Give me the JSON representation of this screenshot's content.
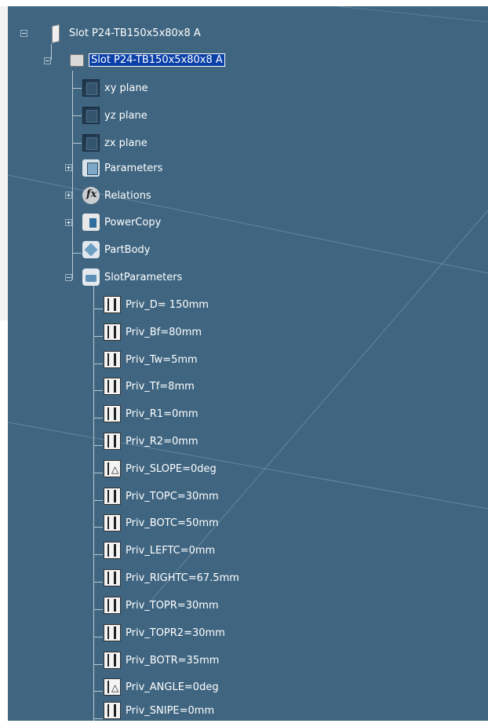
{
  "colors": {
    "background": "#3f6580",
    "tree_line": "#b7c8d4",
    "text": "#ffffff",
    "selection": "#0a3fa8"
  },
  "tree": {
    "root": {
      "label": "Slot P24-TB150x5x80x8 A",
      "icon": "document-icon",
      "expanded": true
    },
    "part": {
      "label": "Slot P24-TB150x5x80x8 A",
      "icon": "part-icon",
      "expanded": true,
      "selected": true
    },
    "children": [
      {
        "label": "xy plane",
        "icon": "plane-icon"
      },
      {
        "label": "yz plane",
        "icon": "plane-icon"
      },
      {
        "label": "zx plane",
        "icon": "plane-icon"
      },
      {
        "label": "Parameters",
        "icon": "parameters-icon",
        "collapsed": true
      },
      {
        "label": "Relations",
        "icon": "relations-icon",
        "collapsed": true
      },
      {
        "label": "PowerCopy",
        "icon": "powercopy-icon",
        "collapsed": true
      },
      {
        "label": "PartBody",
        "icon": "partbody-icon"
      },
      {
        "label": "SlotParameters",
        "icon": "slotparameters-icon",
        "expanded": true
      }
    ],
    "slot_parameters": [
      {
        "label": "Priv_D= 150mm",
        "icon": "length-parameter-icon"
      },
      {
        "label": "Priv_Bf=80mm",
        "icon": "length-parameter-icon"
      },
      {
        "label": "Priv_Tw=5mm",
        "icon": "length-parameter-icon"
      },
      {
        "label": "Priv_Tf=8mm",
        "icon": "length-parameter-icon"
      },
      {
        "label": "Priv_R1=0mm",
        "icon": "length-parameter-icon"
      },
      {
        "label": "Priv_R2=0mm",
        "icon": "length-parameter-icon"
      },
      {
        "label": "Priv_SLOPE=0deg",
        "icon": "angle-parameter-icon"
      },
      {
        "label": "Priv_TOPC=30mm",
        "icon": "length-parameter-icon"
      },
      {
        "label": "Priv_BOTC=50mm",
        "icon": "length-parameter-icon"
      },
      {
        "label": "Priv_LEFTC=0mm",
        "icon": "length-parameter-icon"
      },
      {
        "label": "Priv_RIGHTC=67.5mm",
        "icon": "length-parameter-icon"
      },
      {
        "label": "Priv_TOPR=30mm",
        "icon": "length-parameter-icon"
      },
      {
        "label": "Priv_TOPR2=30mm",
        "icon": "length-parameter-icon"
      },
      {
        "label": "Priv_BOTR=35mm",
        "icon": "length-parameter-icon"
      },
      {
        "label": "Priv_ANGLE=0deg",
        "icon": "angle-parameter-icon"
      },
      {
        "label": "Priv_SNIPE=0mm",
        "icon": "length-parameter-icon"
      }
    ]
  }
}
